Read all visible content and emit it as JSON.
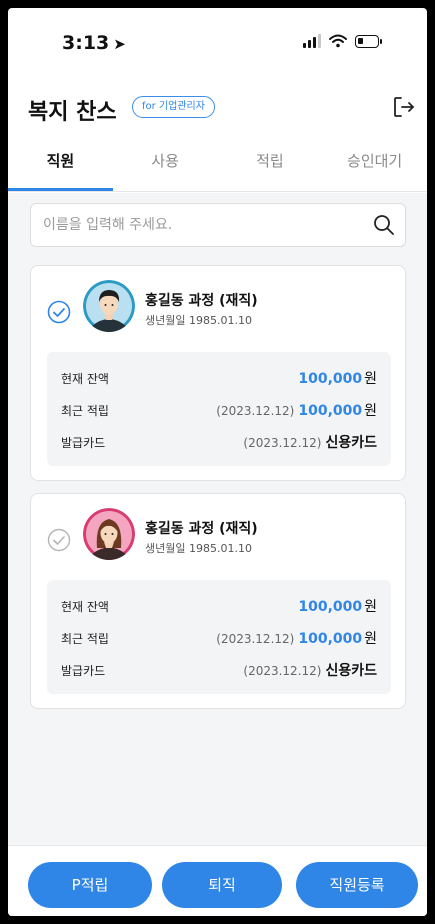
{
  "status_bar": {
    "time": "3:13",
    "location_icon": "location-arrow-icon"
  },
  "header": {
    "title": "복지 찬스",
    "badge": "for 기업관리자",
    "logout_icon": "logout-icon"
  },
  "tabs": [
    {
      "label": "직원",
      "active": true
    },
    {
      "label": "사용",
      "active": false
    },
    {
      "label": "적립",
      "active": false
    },
    {
      "label": "승인대기",
      "active": false
    }
  ],
  "search": {
    "placeholder": "이름을 입력해 주세요.",
    "value": ""
  },
  "employees": [
    {
      "name": "홍길동 과정 (재직)",
      "birth": "생년월일 1985.01.10",
      "checked": true,
      "avatar": "male-avatar-icon",
      "balance_label": "현재 잔액",
      "balance": "100,000",
      "balance_unit": "원",
      "recent_label": "최근 적립",
      "recent_date": "(2023.12.12)",
      "recent_amount": "100,000",
      "recent_unit": "원",
      "card_label": "발급카드",
      "card_date": "(2023.12.12)",
      "card_type": "신용카드"
    },
    {
      "name": "홍길동 과정 (재직)",
      "birth": "생년월일 1985.01.10",
      "checked": false,
      "avatar": "female-avatar-icon",
      "balance_label": "현재 잔액",
      "balance": "100,000",
      "balance_unit": "원",
      "recent_label": "최근 적립",
      "recent_date": "(2023.12.12)",
      "recent_amount": "100,000",
      "recent_unit": "원",
      "card_label": "발급카드",
      "card_date": "(2023.12.12)",
      "card_type": "신용카드"
    }
  ],
  "buttons": {
    "points": "P적립",
    "resign": "퇴직",
    "register": "직원등록"
  },
  "colors": {
    "accent": "#2f86e6",
    "background": "#f4f5f7"
  }
}
